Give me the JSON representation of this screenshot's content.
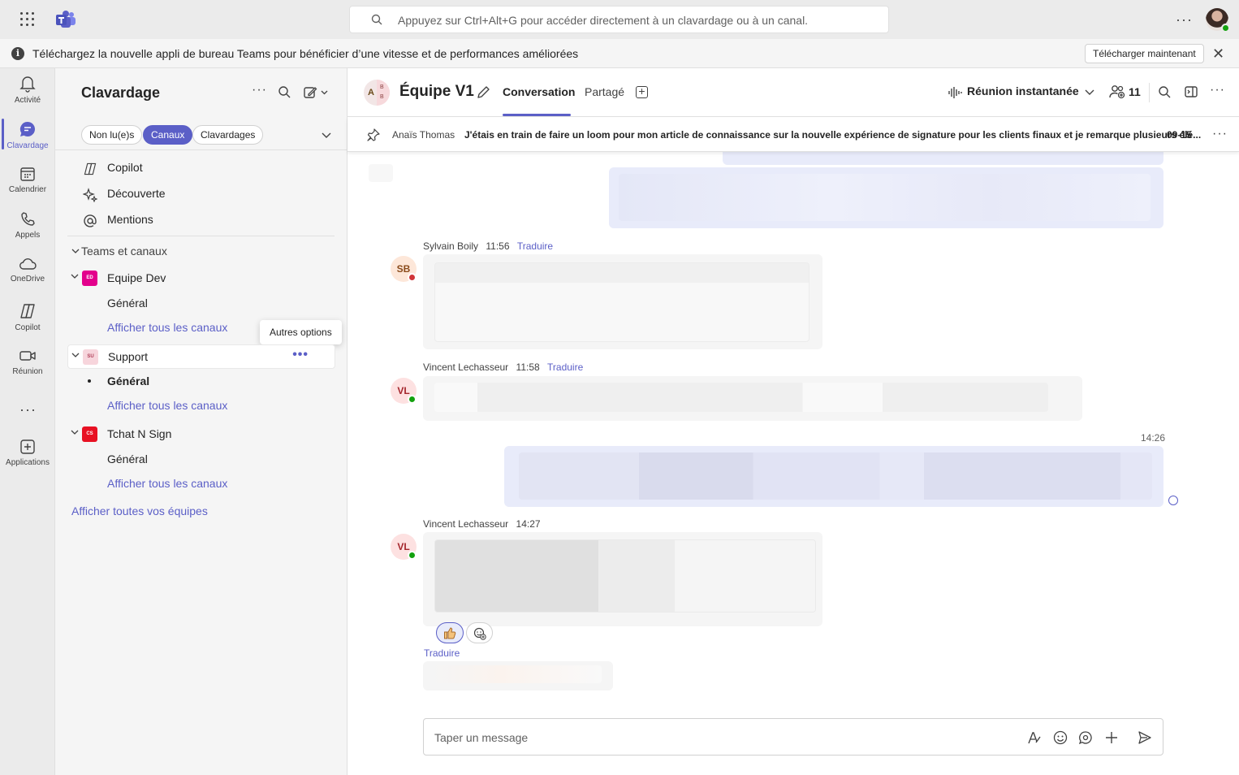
{
  "search": {
    "placeholder": "Appuyez sur Ctrl+Alt+G pour accéder directement à un clavardage ou à un canal."
  },
  "banner": {
    "text": "Téléchargez la nouvelle appli de bureau Teams pour bénéficier d’une vitesse et de performances améliorées",
    "button": "Télécharger maintenant"
  },
  "rail": [
    {
      "label": "Activité",
      "icon": "bell-icon"
    },
    {
      "label": "Clavardage",
      "icon": "chat-icon",
      "active": true
    },
    {
      "label": "Calendrier",
      "icon": "calendar-icon"
    },
    {
      "label": "Appels",
      "icon": "phone-icon"
    },
    {
      "label": "OneDrive",
      "icon": "cloud-icon"
    },
    {
      "label": "Copilot",
      "icon": "copilot-icon"
    },
    {
      "label": "Réunion",
      "icon": "video-icon"
    },
    {
      "label": "Applications",
      "icon": "add-app-icon"
    }
  ],
  "left": {
    "title": "Clavardage",
    "filters": [
      "Non lu(e)s",
      "Canaux",
      "Clavardages"
    ],
    "nav": [
      "Copilot",
      "Découverte",
      "Mentions"
    ],
    "section": "Teams et canaux",
    "teams": [
      {
        "name": "Equipe Dev",
        "initials": "ED",
        "color": "#e3008c",
        "channel": "Général",
        "show_all": "Afficher tous les canaux"
      },
      {
        "name": "Support",
        "initials": "SU",
        "color": "#f7d5dc",
        "channel": "Général",
        "show_all": "Afficher tous les canaux"
      },
      {
        "name": "Tchat N Sign",
        "initials": "CS",
        "color": "#e81123",
        "channel": "Général",
        "show_all": "Afficher tous les canaux"
      }
    ],
    "all_teams": "Afficher toutes vos équipes",
    "tooltip": "Autres options"
  },
  "channel": {
    "avatar_letter": "A",
    "avatar_b": "B",
    "title": "Équipe V1",
    "tabs": [
      "Conversation",
      "Partagé"
    ],
    "meet": "Réunion instantanée",
    "people_count": "11"
  },
  "pinned": {
    "author": "Anaïs Thomas",
    "message": "J'étais en train de faire un loom pour mon article de connaissance sur la nouvelle expérience de signature pour les clients finaux et je remarque plusieurs élé...",
    "date": "09-15"
  },
  "messages": [
    {
      "author": "Sylvain Boily",
      "time": "11:56",
      "translate": "Traduire",
      "initials": "SB",
      "status": "busy"
    },
    {
      "author": "Vincent Lechasseur",
      "time": "11:58",
      "translate": "Traduire",
      "initials": "VL",
      "status": "available"
    },
    {
      "own_time": "14:26"
    },
    {
      "author": "Vincent Lechasseur",
      "time": "14:27",
      "initials": "VL",
      "status": "available"
    }
  ],
  "translate_link": "Traduire",
  "composer": {
    "placeholder": "Taper un message"
  },
  "colors": {
    "accent": "#5b5fc7",
    "available": "#13a10e",
    "busy": "#d13438"
  }
}
